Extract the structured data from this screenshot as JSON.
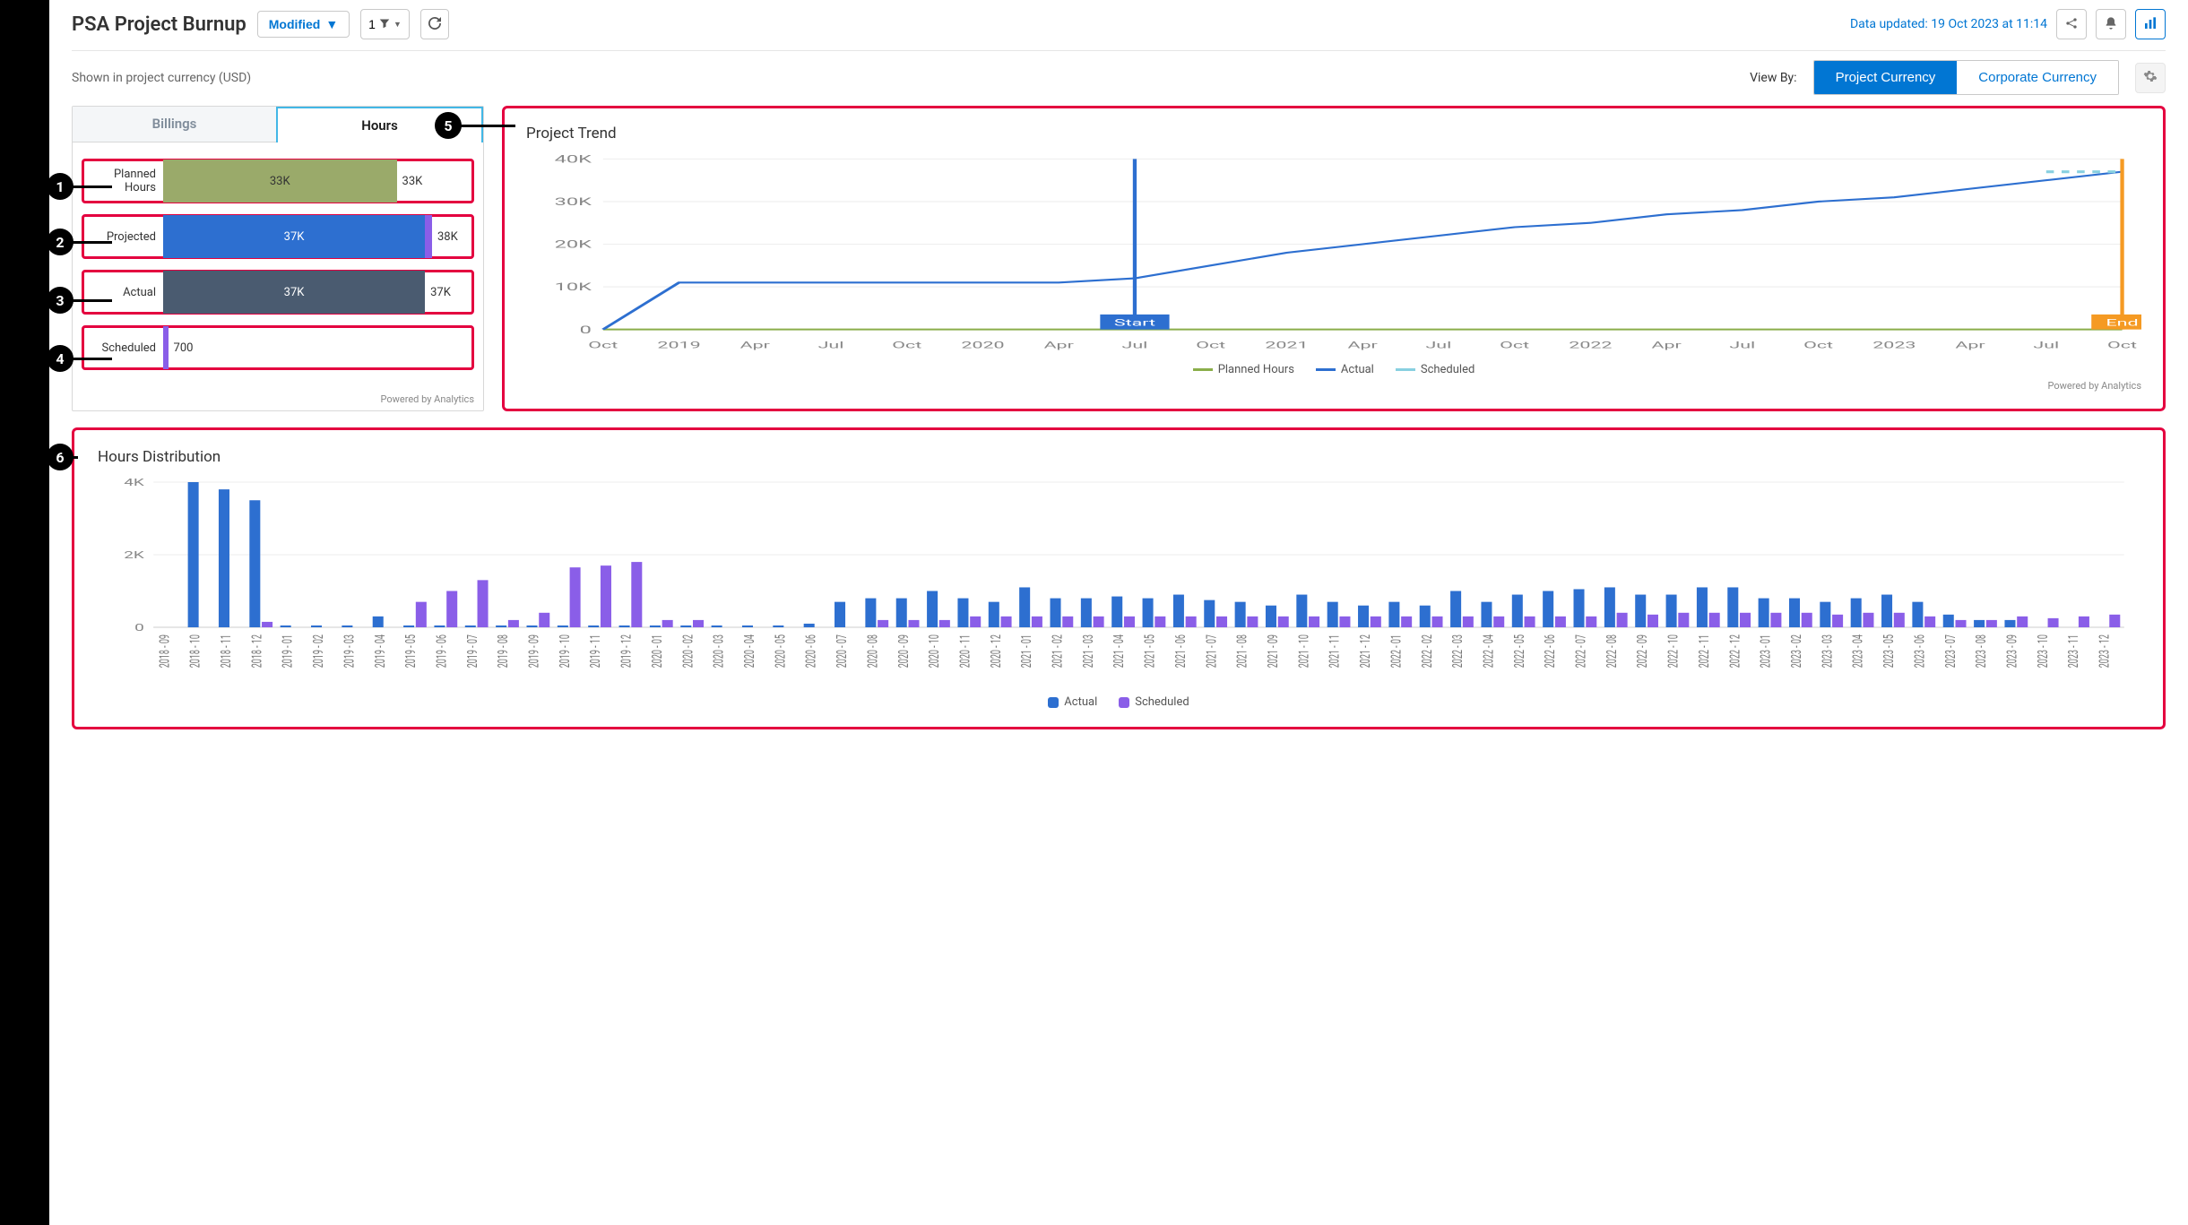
{
  "header": {
    "title": "PSA Project Burnup",
    "modified_label": "Modified",
    "filter_count": "1",
    "data_updated": "Data updated: 19 Oct 2023 at 11:14"
  },
  "subheader": {
    "currency_note": "Shown in project currency (USD)",
    "viewby_label": "View By:",
    "seg_project": "Project Currency",
    "seg_corporate": "Corporate Currency"
  },
  "left_card": {
    "tabs": {
      "billings": "Billings",
      "hours": "Hours"
    },
    "bars": {
      "planned": {
        "label": "Planned Hours",
        "inner": "33K",
        "suffix": "33K"
      },
      "projected": {
        "label": "Projected",
        "inner": "37K",
        "suffix": "38K"
      },
      "actual": {
        "label": "Actual",
        "inner": "37K",
        "suffix": "37K"
      },
      "scheduled": {
        "label": "Scheduled",
        "suffix": "700"
      }
    },
    "powered": "Powered by Analytics"
  },
  "trend": {
    "title": "Project Trend",
    "legend": {
      "planned": "Planned Hours",
      "actual": "Actual",
      "scheduled": "Scheduled"
    },
    "start_label": "Start",
    "end_label": "End",
    "powered": "Powered by Analytics"
  },
  "dist": {
    "title": "Hours Distribution",
    "legend": {
      "actual": "Actual",
      "scheduled": "Scheduled"
    }
  },
  "colors": {
    "planned": "#9aaa6a",
    "projected_main": "#2d6fd0",
    "projected_cap": "#8a5ee8",
    "actual_bar": "#4a5b70",
    "scheduled_tick": "#8a5ee8",
    "trend_actual": "#2d6fd0",
    "trend_planned": "#8aae4a",
    "trend_scheduled": "#88d0e0",
    "start_badge": "#2d6fd0",
    "end_badge": "#f59a23",
    "dist_actual": "#2d6fd0",
    "dist_scheduled": "#8a5ee8",
    "callout_pink": "#e4003f"
  },
  "chart_data": [
    {
      "type": "bar",
      "title": "Hours Summary",
      "categories": [
        "Planned Hours",
        "Projected",
        "Actual",
        "Scheduled"
      ],
      "values_inner": [
        33000,
        37000,
        37000,
        0
      ],
      "values_total": [
        33000,
        38000,
        37000,
        700
      ],
      "xlabel": "",
      "ylabel": "",
      "ylim": [
        0,
        40000
      ]
    },
    {
      "type": "line",
      "title": "Project Trend",
      "x": [
        "Oct 2018",
        "Jan 2019",
        "Apr 2019",
        "Jul 2019",
        "Oct 2019",
        "Jan 2020",
        "Apr 2020",
        "Jul 2020",
        "Oct 2020",
        "Jan 2021",
        "Apr 2021",
        "Jul 2021",
        "Oct 2021",
        "Jan 2022",
        "Apr 2022",
        "Jul 2022",
        "Oct 2022",
        "Jan 2023",
        "Apr 2023",
        "Jul 2023",
        "Oct 2023"
      ],
      "series": [
        {
          "name": "Planned Hours",
          "values": [
            0,
            0,
            0,
            0,
            0,
            0,
            0,
            0,
            0,
            0,
            0,
            0,
            0,
            0,
            0,
            0,
            0,
            0,
            0,
            0,
            0
          ]
        },
        {
          "name": "Actual",
          "values": [
            0,
            11000,
            11000,
            11000,
            11000,
            11000,
            11000,
            12000,
            15000,
            18000,
            20000,
            22000,
            24000,
            25000,
            27000,
            28000,
            30000,
            31000,
            33000,
            35000,
            37000
          ]
        },
        {
          "name": "Scheduled",
          "values": [
            null,
            null,
            null,
            null,
            null,
            null,
            null,
            null,
            null,
            null,
            null,
            null,
            null,
            null,
            null,
            null,
            null,
            null,
            null,
            37000,
            37000
          ]
        }
      ],
      "ylim": [
        0,
        40000
      ],
      "y_ticks": [
        0,
        10000,
        20000,
        30000,
        40000
      ],
      "y_tick_labels": [
        "0",
        "10K",
        "20K",
        "30K",
        "40K"
      ],
      "x_tick_labels": [
        "Oct",
        "2019",
        "Apr",
        "Jul",
        "Oct",
        "2020",
        "Apr",
        "Jul",
        "Oct",
        "2021",
        "Apr",
        "Jul",
        "Oct",
        "2022",
        "Apr",
        "Jul",
        "Oct",
        "2023",
        "Apr",
        "Jul",
        "Oct"
      ],
      "markers": {
        "start_index": 7,
        "end_index": 20
      }
    },
    {
      "type": "bar",
      "title": "Hours Distribution",
      "categories": [
        "2018 - 09",
        "2018 - 10",
        "2018 - 11",
        "2018 - 12",
        "2019 - 01",
        "2019 - 02",
        "2019 - 03",
        "2019 - 04",
        "2019 - 05",
        "2019 - 06",
        "2019 - 07",
        "2019 - 08",
        "2019 - 09",
        "2019 - 10",
        "2019 - 11",
        "2019 - 12",
        "2020 - 01",
        "2020 - 02",
        "2020 - 03",
        "2020 - 04",
        "2020 - 05",
        "2020 - 06",
        "2020 - 07",
        "2020 - 08",
        "2020 - 09",
        "2020 - 10",
        "2020 - 11",
        "2020 - 12",
        "2021 - 01",
        "2021 - 02",
        "2021 - 03",
        "2021 - 04",
        "2021 - 05",
        "2021 - 06",
        "2021 - 07",
        "2021 - 08",
        "2021 - 09",
        "2021 - 10",
        "2021 - 11",
        "2021 - 12",
        "2022 - 01",
        "2022 - 02",
        "2022 - 03",
        "2022 - 04",
        "2022 - 05",
        "2022 - 06",
        "2022 - 07",
        "2022 - 08",
        "2022 - 09",
        "2022 - 10",
        "2022 - 11",
        "2022 - 12",
        "2023 - 01",
        "2023 - 02",
        "2023 - 03",
        "2023 - 04",
        "2023 - 05",
        "2023 - 06",
        "2023 - 07",
        "2023 - 08",
        "2023 - 09",
        "2023 - 10",
        "2023 - 11",
        "2023 - 12"
      ],
      "series": [
        {
          "name": "Actual",
          "values": [
            0,
            4000,
            3800,
            3500,
            50,
            50,
            50,
            300,
            50,
            50,
            50,
            50,
            50,
            50,
            50,
            50,
            50,
            50,
            50,
            50,
            50,
            100,
            700,
            800,
            800,
            1000,
            800,
            700,
            1100,
            800,
            800,
            850,
            800,
            900,
            750,
            700,
            600,
            900,
            700,
            600,
            700,
            600,
            1000,
            700,
            900,
            1000,
            1050,
            1100,
            900,
            900,
            1100,
            1100,
            800,
            800,
            700,
            800,
            900,
            700,
            350,
            200,
            200,
            0,
            0,
            0
          ]
        },
        {
          "name": "Scheduled",
          "values": [
            0,
            0,
            0,
            150,
            0,
            0,
            0,
            0,
            700,
            1000,
            1300,
            200,
            400,
            1650,
            1700,
            1800,
            200,
            200,
            0,
            0,
            0,
            0,
            0,
            200,
            200,
            200,
            300,
            300,
            300,
            300,
            300,
            300,
            300,
            300,
            300,
            300,
            300,
            300,
            300,
            300,
            300,
            300,
            300,
            300,
            300,
            300,
            300,
            400,
            350,
            400,
            400,
            400,
            400,
            400,
            350,
            400,
            400,
            300,
            200,
            200,
            300,
            250,
            300,
            350
          ]
        }
      ],
      "ylim": [
        0,
        4000
      ],
      "y_ticks": [
        0,
        2000,
        4000
      ],
      "y_tick_labels": [
        "0",
        "2K",
        "4K"
      ]
    }
  ]
}
